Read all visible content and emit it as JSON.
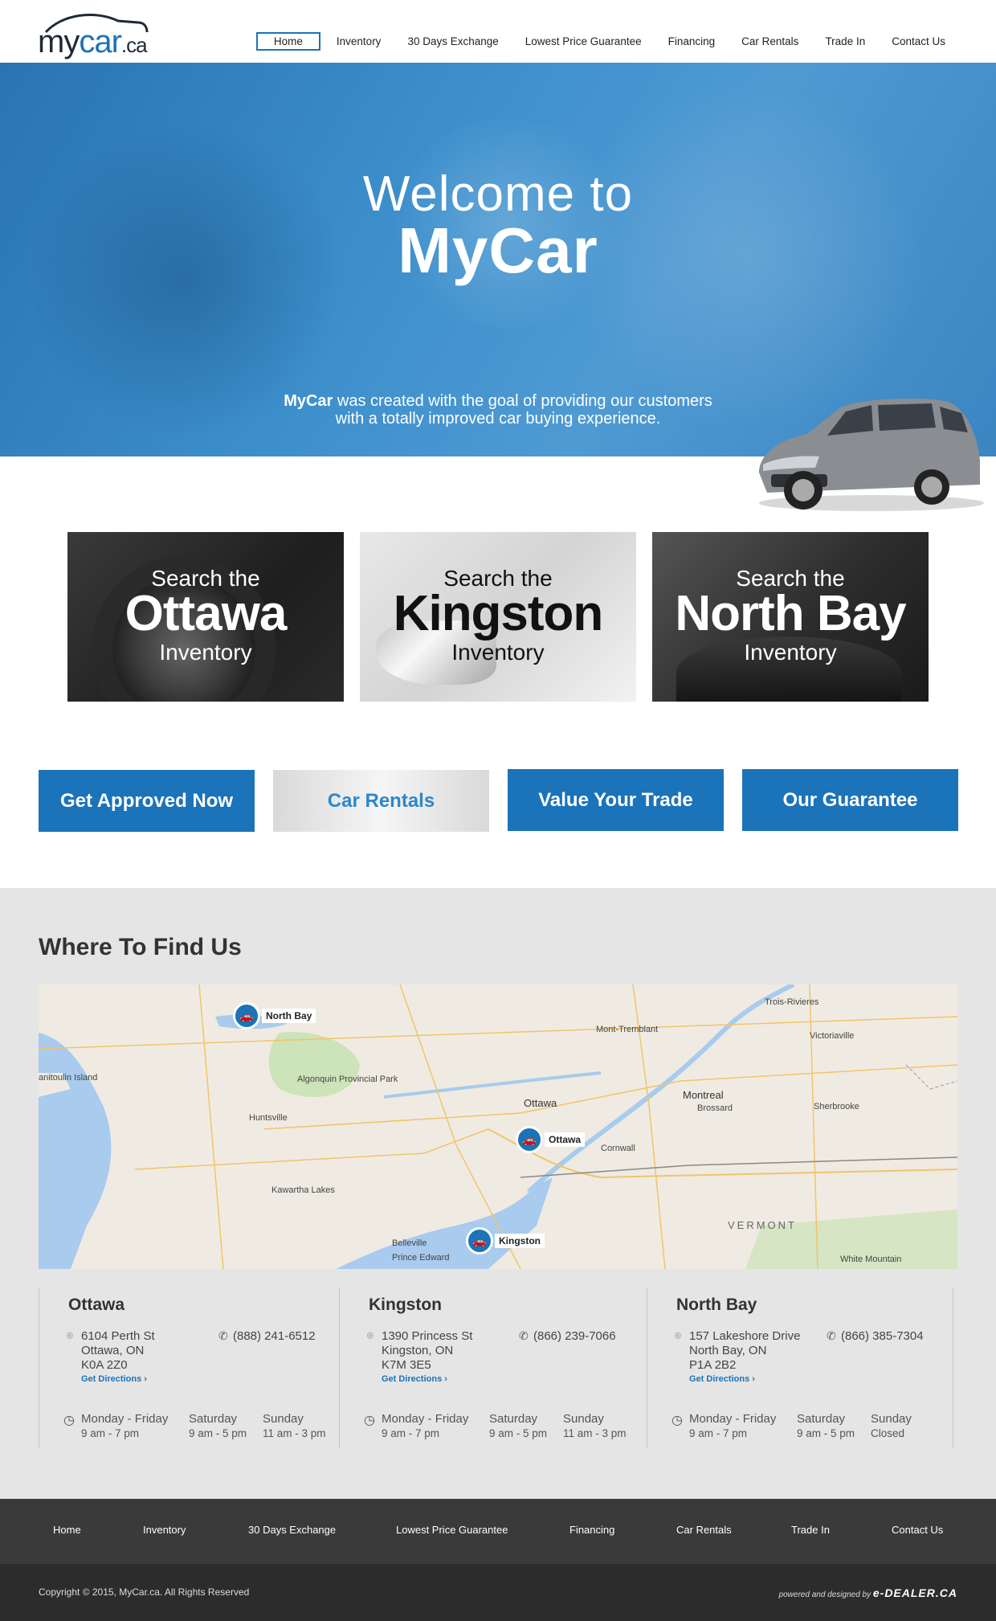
{
  "logo": {
    "word1": "my",
    "word2": "car",
    "word3": ".ca"
  },
  "nav": {
    "items": [
      "Home",
      "Inventory",
      "30 Days Exchange",
      "Lowest Price Guarantee",
      "Financing",
      "Car Rentals",
      "Trade In",
      "Contact Us"
    ],
    "active": "Home"
  },
  "hero": {
    "line1": "Welcome to",
    "line2": "MyCar",
    "sub_bold": "MyCar",
    "sub_rest": " was created with the goal of providing our customers",
    "sub_line2": "with a totally improved car buying experience."
  },
  "tiles": [
    {
      "top": "Search the",
      "city": "Ottawa",
      "bottom": "Inventory"
    },
    {
      "top": "Search the",
      "city": "Kingston",
      "bottom": "Inventory"
    },
    {
      "top": "Search the",
      "city": "North Bay",
      "bottom": "Inventory"
    }
  ],
  "cta": [
    "Get Approved Now",
    "Car Rentals",
    "Value Your Trade",
    "Our Guarantee"
  ],
  "find": {
    "title": "Where To Find Us",
    "map_pins": [
      "North Bay",
      "Ottawa",
      "Kingston"
    ],
    "map_labels": [
      "Trois-Rivieres",
      "Mont-Tremblant",
      "Victoriaville",
      "Montreal",
      "Brossard",
      "Sherbrooke",
      "Ottawa",
      "Cornwall",
      "Algonquin Provincial Park",
      "Huntsville",
      "Kawartha Lakes",
      "Belleville",
      "Prince Edward",
      "VERMONT",
      "White Mountain",
      "anitoulin Island"
    ],
    "locations": [
      {
        "name": "Ottawa",
        "addr1": "6104 Perth St",
        "addr2": "Ottawa, ON",
        "addr3": "K0A 2Z0",
        "phone": "(888) 241-6512",
        "directions": "Get Directions",
        "hours": [
          {
            "day": "Monday - Friday",
            "time": "9 am - 7 pm"
          },
          {
            "day": "Saturday",
            "time": "9 am - 5 pm"
          },
          {
            "day": "Sunday",
            "time": "11 am - 3 pm"
          }
        ]
      },
      {
        "name": "Kingston",
        "addr1": "1390 Princess St",
        "addr2": "Kingston, ON",
        "addr3": "K7M 3E5",
        "phone": "(866) 239-7066",
        "directions": "Get Directions",
        "hours": [
          {
            "day": "Monday - Friday",
            "time": "9 am - 7 pm"
          },
          {
            "day": "Saturday",
            "time": "9 am - 5 pm"
          },
          {
            "day": "Sunday",
            "time": "11 am - 3 pm"
          }
        ]
      },
      {
        "name": "North Bay",
        "addr1": "157 Lakeshore Drive",
        "addr2": "North Bay, ON",
        "addr3": "P1A 2B2",
        "phone": "(866) 385-7304",
        "directions": "Get Directions",
        "hours": [
          {
            "day": "Monday - Friday",
            "time": "9 am - 7 pm"
          },
          {
            "day": "Saturday",
            "time": "9 am - 5 pm"
          },
          {
            "day": "Sunday",
            "time": "Closed"
          }
        ]
      }
    ]
  },
  "footer": {
    "nav": [
      "Home",
      "Inventory",
      "30 Days Exchange",
      "Lowest Price Guarantee",
      "Financing",
      "Car Rentals",
      "Trade In",
      "Contact Us"
    ],
    "copyright": "Copyright © 2015, MyCar.ca. All Rights Reserved",
    "powered": "powered and designed by",
    "brand": "e-DEALER.CA"
  },
  "colors": {
    "brand_blue": "#1b73b9",
    "footer_dark": "#3a3a3a",
    "footer_darker": "#2c2c2c",
    "section_gray": "#e5e5e5"
  }
}
